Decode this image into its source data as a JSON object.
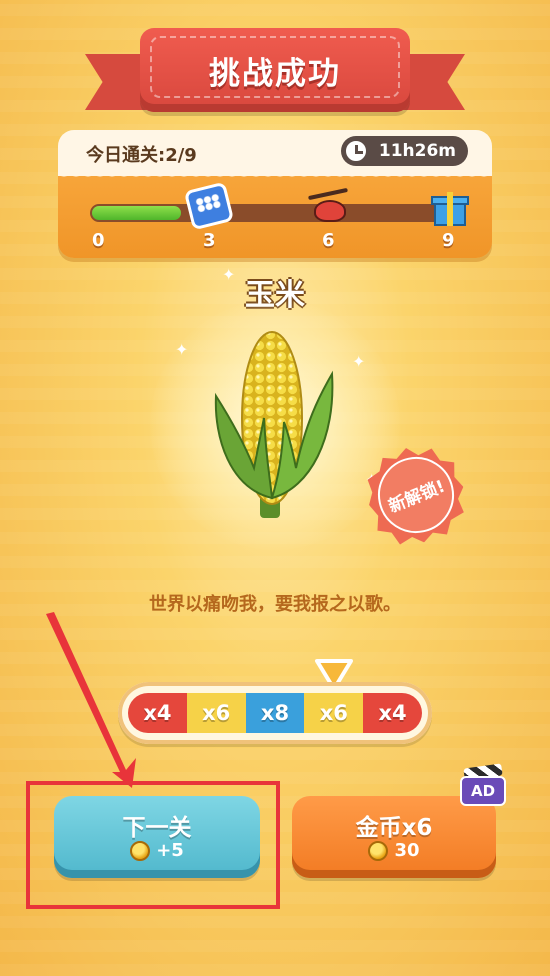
{
  "title": "挑战成功",
  "progress": {
    "today_label": "今日通关:2/9",
    "timer": "11h26m",
    "fill_fraction": 0.24,
    "milestones": [
      "0",
      "3",
      "6",
      "9"
    ]
  },
  "item": {
    "name": "玉米",
    "badge": "新解锁!",
    "quote": "世界以痛吻我，要我报之以歌。"
  },
  "multiplier": {
    "cells": [
      {
        "label": "x4",
        "color": "red"
      },
      {
        "label": "x6",
        "color": "yellow"
      },
      {
        "label": "x8",
        "color": "blue"
      },
      {
        "label": "x6",
        "color": "yellow"
      },
      {
        "label": "x4",
        "color": "red"
      }
    ]
  },
  "buttons": {
    "next": {
      "label": "下一关",
      "reward": "+5"
    },
    "coins": {
      "label": "金币x6",
      "reward": "30"
    },
    "ad": "AD"
  },
  "colors": {
    "annotation": "#e8343a",
    "next_button": "#5cc4d6",
    "coin_button": "#f58630",
    "ribbon": "#e4503f"
  }
}
